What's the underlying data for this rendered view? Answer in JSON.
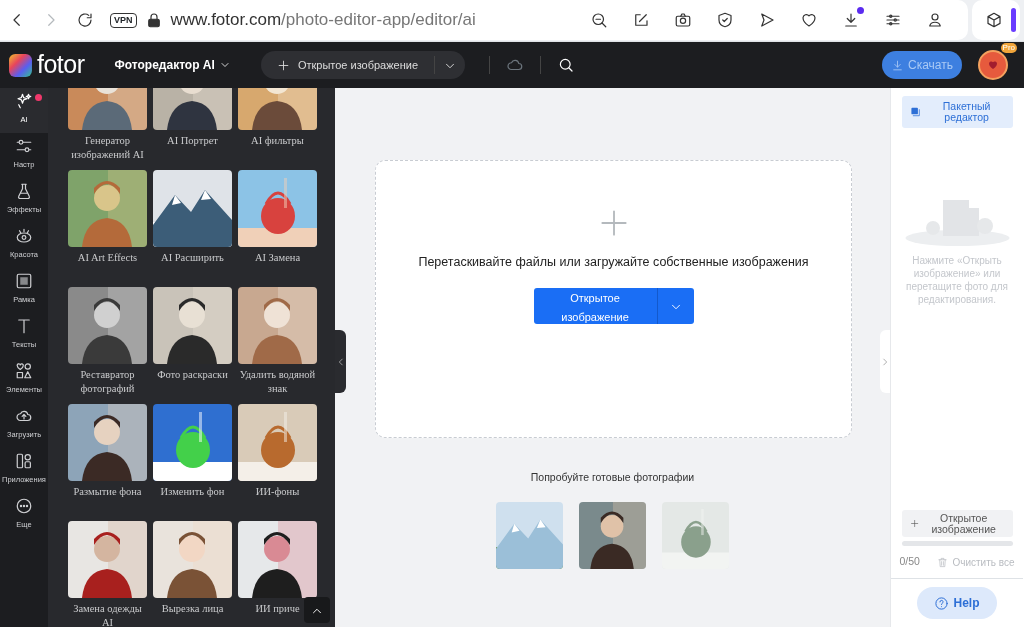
{
  "browser": {
    "vpn_label": "VPN",
    "url_host": "www.fotor.com",
    "url_path": "/photo-editor-app/editor/ai",
    "download_notification": true
  },
  "app_bar": {
    "logo": "fotor",
    "mode_menu": "Фоторедактор AI",
    "open_button": "Открытое изображение",
    "download_button": {
      "label": "Скачать",
      "disabled": true
    },
    "avatar_badge": "Pro"
  },
  "rail": [
    {
      "label": "AI",
      "selected": true,
      "notification": true
    },
    {
      "label": "Настр",
      "selected": false,
      "notification": false
    },
    {
      "label": "Эффекты",
      "selected": false,
      "notification": false
    },
    {
      "label": "Красота",
      "selected": false,
      "notification": false
    },
    {
      "label": "Рамка",
      "selected": false,
      "notification": false
    },
    {
      "label": "Тексты",
      "selected": false,
      "notification": false
    },
    {
      "label": "Элементы",
      "selected": false,
      "notification": false
    },
    {
      "label": "Загрузить",
      "selected": false,
      "notification": false
    },
    {
      "label": "Приложения",
      "selected": false,
      "notification": false
    },
    {
      "label": "Еще",
      "selected": false,
      "notification": false
    }
  ],
  "tools": [
    {
      "label": "Генератор изображений AI"
    },
    {
      "label": "AI Портрет"
    },
    {
      "label": "AI фильтры"
    },
    {
      "label": "AI Art Effects"
    },
    {
      "label": "AI Расширить"
    },
    {
      "label": "AI Замена"
    },
    {
      "label": "Реставратор фотографий"
    },
    {
      "label": "Фото раскраски"
    },
    {
      "label": "Удалить водяной знак"
    },
    {
      "label": "Размытие фона"
    },
    {
      "label": "Изменить фон"
    },
    {
      "label": "ИИ-фоны"
    },
    {
      "label": "Замена одежды AI"
    },
    {
      "label": "Вырезка лица"
    },
    {
      "label": "ИИ приче"
    }
  ],
  "canvas": {
    "drop_hint": "Перетаскивайте файлы или загружайте собственные изображения",
    "open_button": "Открытое изображение",
    "samples_title": "Попробуйте готовые фотографии"
  },
  "right_panel": {
    "batch_button": "Пакетный редактор",
    "empty_hint": "Нажмите «Открыть изображение» или перетащите фото для редактирования.",
    "open_button": "Открытое изображение",
    "progress": {
      "level": 0
    },
    "counter": "0/50",
    "clear_button": "Очистить все",
    "help_button": "Help"
  }
}
